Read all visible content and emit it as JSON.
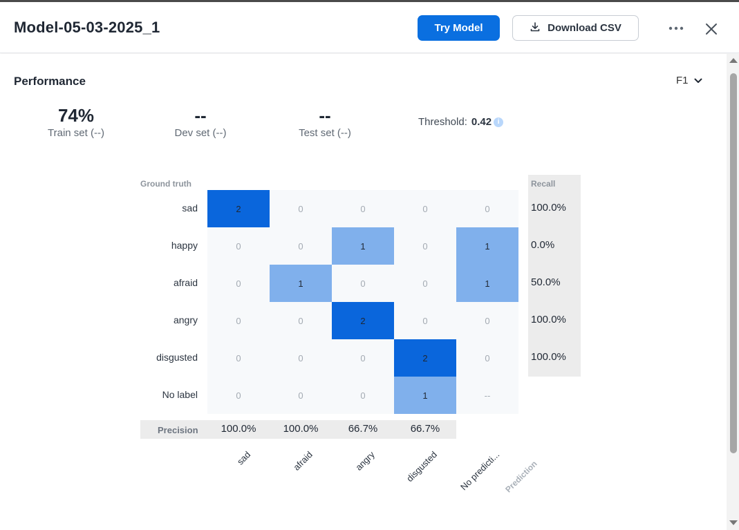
{
  "header": {
    "title": "Model-05-03-2025_1",
    "try_model_label": "Try Model",
    "download_csv_label": "Download CSV",
    "more_icon": "more-horizontal-icon",
    "close_icon": "close-icon",
    "download_icon": "download-icon"
  },
  "performance": {
    "title": "Performance",
    "metric_selected": "F1",
    "stats": [
      {
        "value": "74%",
        "label": "Train set (--)"
      },
      {
        "value": "--",
        "label": "Dev set (--)"
      },
      {
        "value": "--",
        "label": "Test set (--)"
      }
    ],
    "threshold_label": "Threshold:",
    "threshold_value": "0.42"
  },
  "confusion_matrix": {
    "ground_truth_title": "Ground truth",
    "recall_title": "Recall",
    "precision_title": "Precision",
    "prediction_title": "Prediction",
    "rows": [
      "sad",
      "happy",
      "afraid",
      "angry",
      "disgusted",
      "No label"
    ],
    "columns": [
      "sad",
      "afraid",
      "angry",
      "disgusted",
      "No predicti..."
    ],
    "cells": [
      [
        "2",
        "0",
        "0",
        "0",
        "0"
      ],
      [
        "0",
        "0",
        "1",
        "0",
        "1"
      ],
      [
        "0",
        "1",
        "0",
        "0",
        "1"
      ],
      [
        "0",
        "0",
        "2",
        "0",
        "0"
      ],
      [
        "0",
        "0",
        "0",
        "2",
        "0"
      ],
      [
        "0",
        "0",
        "0",
        "1",
        "--"
      ]
    ],
    "recall": [
      "100.0%",
      "0.0%",
      "50.0%",
      "100.0%",
      "100.0%"
    ],
    "precision": [
      "100.0%",
      "100.0%",
      "66.7%",
      "66.7%"
    ],
    "colors": {
      "strong": "#0a66dc",
      "light": "#80b0ec",
      "empty": "#f7f9fb",
      "zero_text": "#a3aab2"
    }
  }
}
